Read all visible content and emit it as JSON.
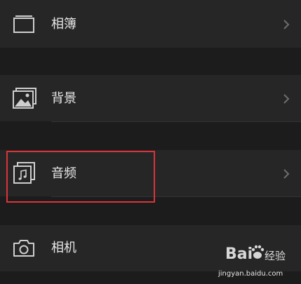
{
  "menu": {
    "albums_label": "相簿",
    "background_label": "背景",
    "audio_label": "音频",
    "camera_label": "相机"
  },
  "watermark": {
    "brand": "Bai",
    "sub": "经验",
    "url": "jingyan.baidu.com"
  },
  "colors": {
    "highlight": "#d9343a",
    "row_bg": "#262627",
    "page_bg": "#1c1c1d",
    "text": "#e8e8e8"
  },
  "icons": {
    "albums": "album-icon",
    "background": "image-icon",
    "audio": "music-note-icon",
    "camera": "camera-icon",
    "chevron": "chevron-right-icon"
  }
}
